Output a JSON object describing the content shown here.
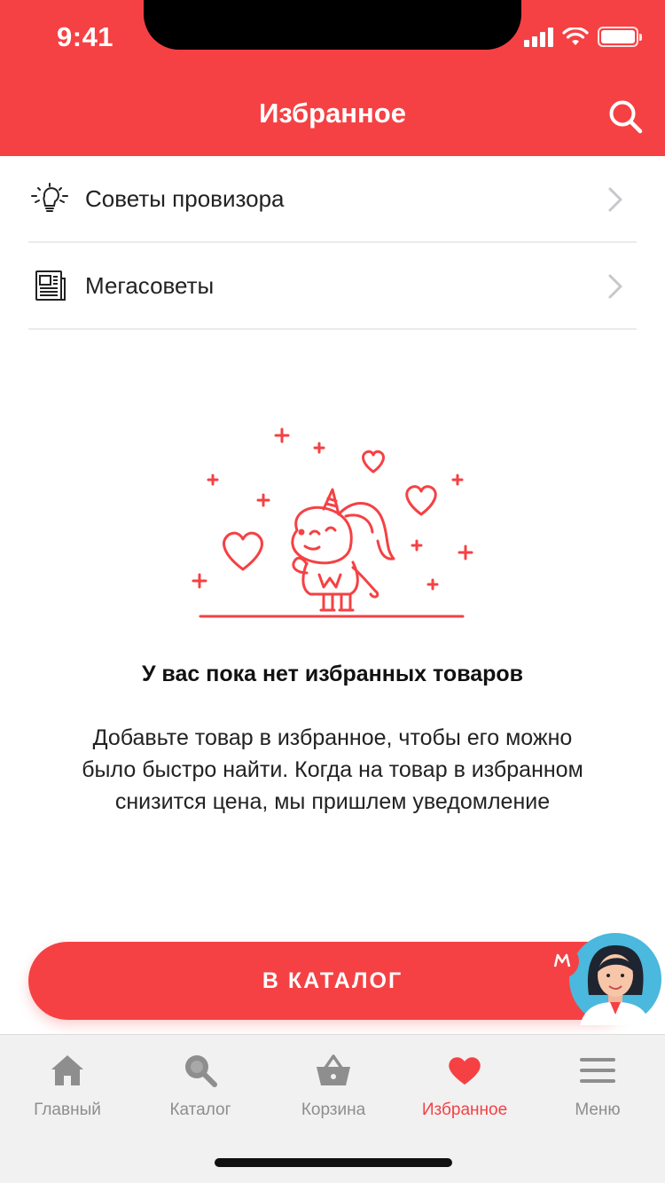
{
  "status_bar": {
    "time": "9:41"
  },
  "header": {
    "title": "Избранное",
    "search_icon": "search-icon"
  },
  "list": {
    "items": [
      {
        "label": "Советы провизора",
        "icon": "lightbulb-icon"
      },
      {
        "label": "Мегасоветы",
        "icon": "newspaper-icon"
      }
    ]
  },
  "empty_state": {
    "title": "У вас пока нет избранных товаров",
    "description": "Добавьте товар в избранное, чтобы его можно было быстро найти. Когда на товар в избранном снизится цена, мы пришлем уведомление",
    "illustration": "unicorn-with-hearts-illustration"
  },
  "cta": {
    "label": "В КАТАЛОГ"
  },
  "assistant": {
    "icon": "pharmacist-avatar",
    "badge_letter": "M"
  },
  "tabbar": {
    "tabs": [
      {
        "label": "Главный",
        "icon": "home-icon",
        "active": false
      },
      {
        "label": "Каталог",
        "icon": "search-icon",
        "active": false
      },
      {
        "label": "Корзина",
        "icon": "basket-icon",
        "active": false
      },
      {
        "label": "Избранное",
        "icon": "heart-icon",
        "active": true
      },
      {
        "label": "Меню",
        "icon": "menu-icon",
        "active": false
      }
    ]
  },
  "colors": {
    "accent": "#f54144",
    "tab_inactive": "#8e8e8e",
    "tabbar_bg": "#f1f1f1"
  }
}
